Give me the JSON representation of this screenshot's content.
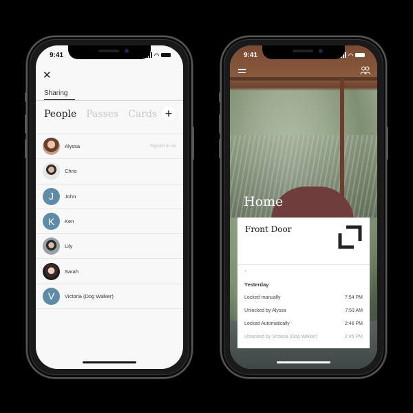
{
  "left_phone": {
    "status_time": "9:41",
    "close_label": "✕",
    "header_tab": "Sharing",
    "segments": [
      {
        "label": "People",
        "active": true
      },
      {
        "label": "Passes",
        "active": false
      },
      {
        "label": "Cards",
        "active": false
      }
    ],
    "add_label": "+",
    "people": [
      {
        "name": "Alyssa",
        "avatar": "photo",
        "note": "Signed in as"
      },
      {
        "name": "Chris",
        "avatar": "photo"
      },
      {
        "name": "John",
        "avatar": "letter",
        "initial": "J"
      },
      {
        "name": "Ken",
        "avatar": "letter",
        "initial": "K"
      },
      {
        "name": "Lily",
        "avatar": "photo"
      },
      {
        "name": "Sarah",
        "avatar": "photo"
      },
      {
        "name": "Victoria (Dog Walker)",
        "avatar": "letter",
        "initial": "V"
      }
    ]
  },
  "right_phone": {
    "status_time": "9:41",
    "menu_icon": "hamburger-icon",
    "people_icon": "people-icon",
    "people_glyph": "👥",
    "home_title": "Home",
    "lock_name": "Front Door",
    "lock_state_icon": "lock-corner-icon",
    "chevron_glyph": "^",
    "day_label": "Yesterday",
    "activity": [
      {
        "event": "Locked manually",
        "time": "7:54 PM",
        "faded": false
      },
      {
        "event": "Unlocked by Alyssa",
        "time": "7:53 AM",
        "faded": false
      },
      {
        "event": "Locked Automatically",
        "time": "2:46 PM",
        "faded": false
      },
      {
        "event": "Unlocked by Victoria (Dog Walker)",
        "time": "2:45 PM",
        "faded": true
      }
    ]
  },
  "colors": {
    "avatar_letter_bg": "#5e8ca8",
    "screen_bg": "#f8f8f8",
    "inactive_tab": "#c8c8c8"
  }
}
